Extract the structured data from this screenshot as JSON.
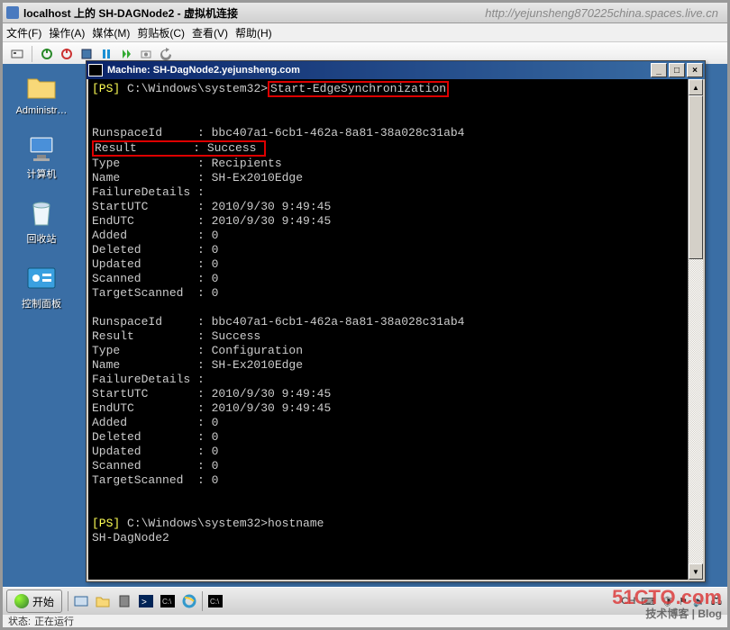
{
  "watermark_url": "http://yejunsheng870225china.spaces.live.cn",
  "watermark_logo_main": "51CTO.com",
  "watermark_logo_sub": "技术博客 | Blog",
  "vm_window": {
    "title": "localhost 上的 SH-DAGNode2 - 虚拟机连接",
    "menu": [
      "文件(F)",
      "操作(A)",
      "媒体(M)",
      "剪贴板(C)",
      "查看(V)",
      "帮助(H)"
    ],
    "status_label": "状态:",
    "status_value": "正在运行"
  },
  "desktop_icons": [
    {
      "label": "Administr…",
      "name": "admin-folder-icon"
    },
    {
      "label": "计算机",
      "name": "computer-icon"
    },
    {
      "label": "回收站",
      "name": "recycle-bin-icon"
    },
    {
      "label": "控制面板",
      "name": "control-panel-icon"
    }
  ],
  "cmd": {
    "title": "Machine: SH-DagNode2.yejunsheng.com",
    "prompt_prefix": "[PS]",
    "prompt_path": " C:\\Windows\\system32>",
    "highlighted_command": "Start-EdgeSynchronization",
    "result_hl_key": "Result",
    "result_hl_sep": "      : ",
    "result_hl_val": "Success",
    "blocks": [
      {
        "lines": [
          [
            "RunspaceId",
            "bbc407a1-6cb1-462a-8a81-38a028c31ab4"
          ],
          [
            "Type",
            "Recipients"
          ],
          [
            "Name",
            "SH-Ex2010Edge"
          ],
          [
            "FailureDetails",
            ""
          ],
          [
            "StartUTC",
            "2010/9/30 9:49:45"
          ],
          [
            "EndUTC",
            "2010/9/30 9:49:45"
          ],
          [
            "Added",
            "0"
          ],
          [
            "Deleted",
            "0"
          ],
          [
            "Updated",
            "0"
          ],
          [
            "Scanned",
            "0"
          ],
          [
            "TargetScanned",
            "0"
          ]
        ]
      },
      {
        "lines": [
          [
            "RunspaceId",
            "bbc407a1-6cb1-462a-8a81-38a028c31ab4"
          ],
          [
            "Result",
            "Success"
          ],
          [
            "Type",
            "Configuration"
          ],
          [
            "Name",
            "SH-Ex2010Edge"
          ],
          [
            "FailureDetails",
            ""
          ],
          [
            "StartUTC",
            "2010/9/30 9:49:45"
          ],
          [
            "EndUTC",
            "2010/9/30 9:49:45"
          ],
          [
            "Added",
            "0"
          ],
          [
            "Deleted",
            "0"
          ],
          [
            "Updated",
            "0"
          ],
          [
            "Scanned",
            "0"
          ],
          [
            "TargetScanned",
            "0"
          ]
        ]
      }
    ],
    "second_command": "hostname",
    "hostname_output": "SH-DagNode2"
  },
  "taskbar": {
    "start_label": "开始",
    "tray_lang": "CH"
  }
}
